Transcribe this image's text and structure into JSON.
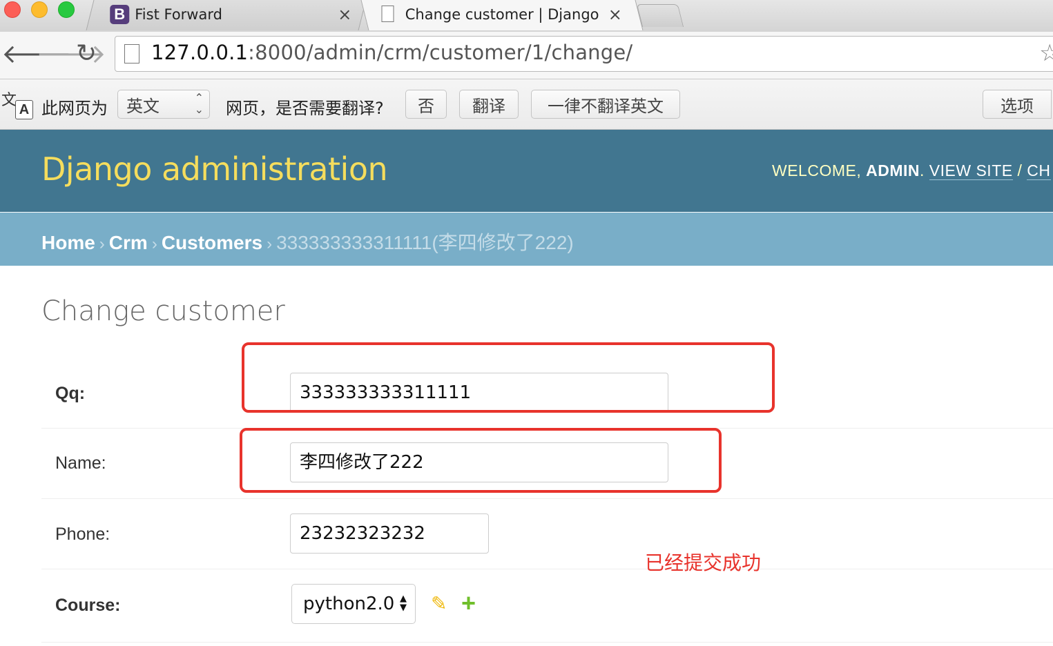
{
  "browser": {
    "tabs": [
      {
        "title": "Fist Forward",
        "favicon_letter": "B"
      },
      {
        "title": "Change customer | Django"
      }
    ],
    "url_host": "127.0.0.1",
    "url_path": ":8000/admin/crm/customer/1/change/",
    "translate_bar": {
      "prompt_prefix": "此网页为",
      "language": "英文",
      "question": "网页，是否需要翻译?",
      "no_button": "否",
      "translate_button": "翻译",
      "never_button": "一律不翻译英文",
      "options_button": "选项"
    }
  },
  "admin": {
    "site_name": "Django administration",
    "welcome": "WELCOME, ",
    "username": "ADMIN",
    "view_site": "VIEW SITE",
    "change_password_partial": "CH",
    "breadcrumbs": {
      "home": "Home",
      "app": "Crm",
      "model": "Customers",
      "current": "333333333311111(李四修改了222)",
      "separator": "›"
    },
    "page_title": "Change customer",
    "fields": {
      "qq": {
        "label": "Qq:",
        "value": "333333333311111"
      },
      "name": {
        "label": "Name:",
        "value": "李四修改了222"
      },
      "phone": {
        "label": "Phone:",
        "value": "23232323232"
      },
      "course": {
        "label": "Course:",
        "value": "python2.0"
      }
    }
  },
  "annotation": {
    "text": "已经提交成功",
    "color": "#e8332c"
  },
  "colors": {
    "header_bg": "#417690",
    "breadcrumb_bg": "#79aec8",
    "site_name": "#f5dd5d"
  },
  "icons": [
    "back-arrow-icon",
    "forward-arrow-icon",
    "reload-icon",
    "page-icon",
    "star-icon",
    "translate-icon",
    "pencil-icon",
    "plus-icon",
    "close-icon"
  ]
}
